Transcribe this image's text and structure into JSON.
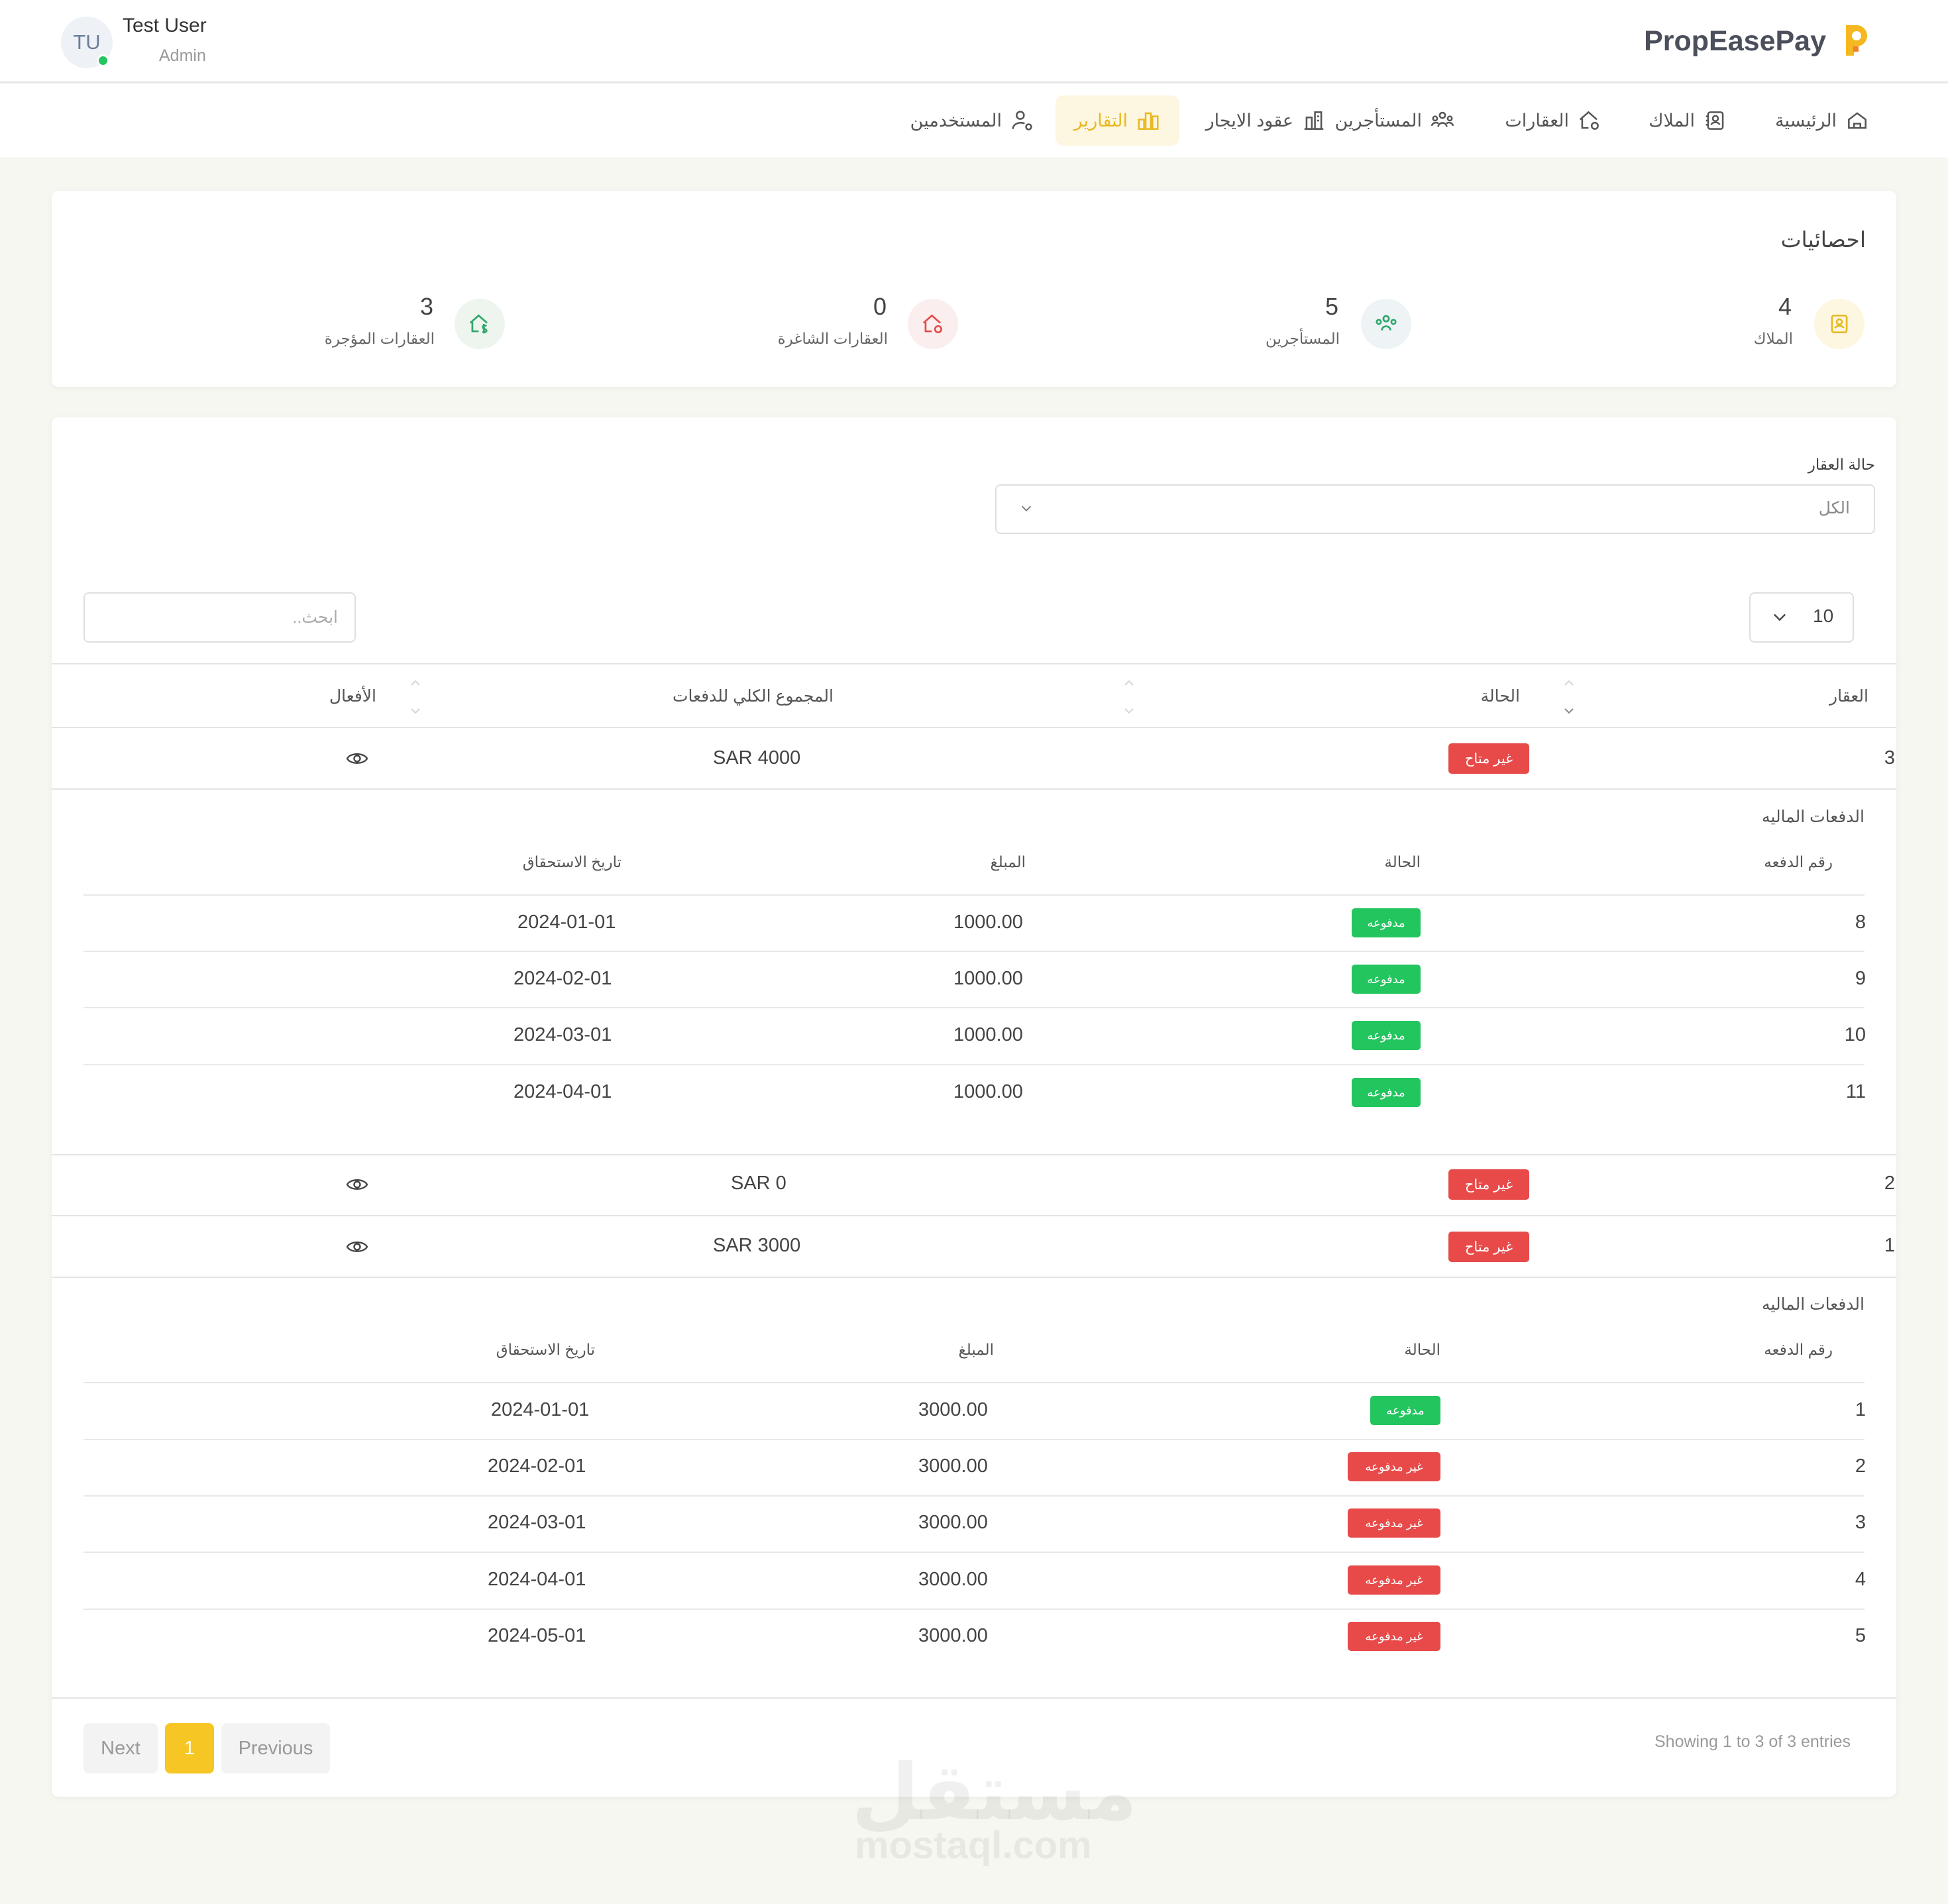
{
  "user": {
    "initials": "TU",
    "name": "Test User",
    "role": "Admin"
  },
  "brand": {
    "name": "PropEasePay",
    "accent": "#f5b820"
  },
  "nav": {
    "home": "الرئيسية",
    "owners": "الملاك",
    "properties": "العقارات",
    "tenants": "المستأجرين",
    "leases": "عقود الايجار",
    "reports": "التقارير",
    "users": "المستخدمين",
    "active": "reports"
  },
  "stats": {
    "title": "احصائيات",
    "items": [
      {
        "value": "4",
        "label": "الملاك",
        "icon": "owners-icon"
      },
      {
        "value": "5",
        "label": "المستأجرين",
        "icon": "tenants-icon"
      },
      {
        "value": "0",
        "label": "العقارات الشاغرة",
        "icon": "vacant-house-icon"
      },
      {
        "value": "3",
        "label": "العقارات المؤجرة",
        "icon": "rented-house-icon"
      }
    ]
  },
  "filter": {
    "label": "حالة العقار",
    "value": "الكل"
  },
  "table_controls": {
    "page_size": "10",
    "search_placeholder": "ابحث.."
  },
  "table": {
    "headers": {
      "property": "العقار",
      "status": "الحالة",
      "total": "المجموع الكلي للدفعات",
      "actions": "الأفعال"
    },
    "rows": [
      {
        "property": "3",
        "status": "غير متاح",
        "total": "SAR 4000"
      },
      {
        "property": "2",
        "status": "غير متاح",
        "total": "SAR 0"
      },
      {
        "property": "1",
        "status": "غير متاح",
        "total": "SAR 3000"
      }
    ]
  },
  "payments_a": {
    "title": "الدفعات الماليه",
    "headers": {
      "number": "رقم الدفعه",
      "status": "الحالة",
      "amount": "المبلغ",
      "due": "تاريخ الاستحقاق"
    },
    "rows": [
      {
        "number": "8",
        "status": "مدفوعه",
        "amount": "1000.00",
        "due": "2024-01-01"
      },
      {
        "number": "9",
        "status": "مدفوعه",
        "amount": "1000.00",
        "due": "2024-02-01"
      },
      {
        "number": "10",
        "status": "مدفوعه",
        "amount": "1000.00",
        "due": "2024-03-01"
      },
      {
        "number": "11",
        "status": "مدفوعه",
        "amount": "1000.00",
        "due": "2024-04-01"
      }
    ]
  },
  "payments_b": {
    "title": "الدفعات الماليه",
    "headers": {
      "number": "رقم الدفعه",
      "status": "الحالة",
      "amount": "المبلغ",
      "due": "تاريخ الاستحقاق"
    },
    "rows": [
      {
        "number": "1",
        "status": "مدفوعه",
        "amount": "3000.00",
        "due": "2024-01-01"
      },
      {
        "number": "2",
        "status": "غير مدفوعه",
        "amount": "3000.00",
        "due": "2024-02-01"
      },
      {
        "number": "3",
        "status": "غير مدفوعه",
        "amount": "3000.00",
        "due": "2024-03-01"
      },
      {
        "number": "4",
        "status": "غير مدفوعه",
        "amount": "3000.00",
        "due": "2024-04-01"
      },
      {
        "number": "5",
        "status": "غير مدفوعه",
        "amount": "3000.00",
        "due": "2024-05-01"
      }
    ]
  },
  "pagination": {
    "info": "Showing 1 to 3 of 3 entries",
    "previous": "Previous",
    "current": "1",
    "next": "Next"
  },
  "watermark": {
    "arabic": "مستقل",
    "latin": "mostaql.com"
  },
  "colors": {
    "paid": "#22c55e",
    "unpaid": "#e84a4a",
    "accent": "#f6c624"
  }
}
